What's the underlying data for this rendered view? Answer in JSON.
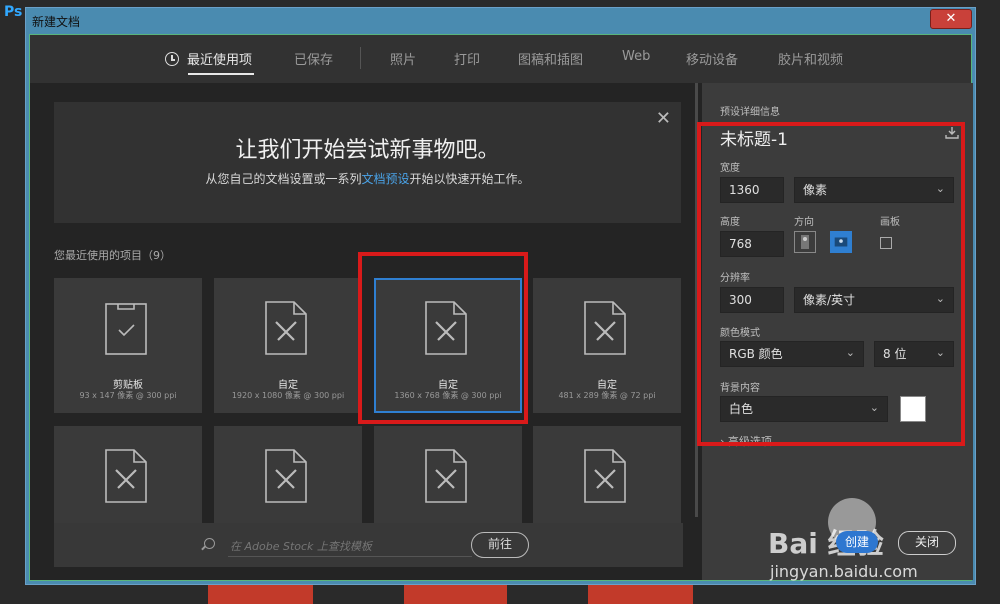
{
  "app": {
    "logo": "Ps",
    "window_title": "新建文档",
    "close_glyph": "✕"
  },
  "tabs": [
    {
      "label": "最近使用项"
    },
    {
      "label": "已保存"
    },
    {
      "label": "照片"
    },
    {
      "label": "打印"
    },
    {
      "label": "图稿和插图"
    },
    {
      "label": "Web"
    },
    {
      "label": "移动设备"
    },
    {
      "label": "胶片和视频"
    }
  ],
  "welcome": {
    "heading": "让我们开始尝试新事物吧。",
    "sub_before": "从您自己的文档设置或一系列",
    "sub_link": "文档预设",
    "sub_after": "开始以快速开始工作。",
    "close_glyph": "✕"
  },
  "recent": {
    "label": "您最近使用的项目（9）",
    "items": [
      {
        "name": "剪贴板",
        "meta": "93 x 147 像素 @ 300 ppi",
        "icon": "clipboard-icon"
      },
      {
        "name": "自定",
        "meta": "1920 x 1080 像素 @ 300 ppi",
        "icon": "custom-document-icon"
      },
      {
        "name": "自定",
        "meta": "1360 x 768 像素 @ 300 ppi",
        "icon": "custom-document-icon",
        "selected": true
      },
      {
        "name": "自定",
        "meta": "481 x 289 像素 @ 72 ppi",
        "icon": "custom-document-icon"
      },
      {
        "name": "",
        "meta": "",
        "icon": "custom-document-icon"
      },
      {
        "name": "",
        "meta": "",
        "icon": "custom-document-icon"
      },
      {
        "name": "",
        "meta": "",
        "icon": "custom-document-icon"
      },
      {
        "name": "",
        "meta": "",
        "icon": "custom-document-icon"
      }
    ]
  },
  "search": {
    "placeholder": "在 Adobe Stock 上查找模板",
    "go_label": "前往"
  },
  "details": {
    "section_label": "预设详细信息",
    "doc_name": "未标题-1",
    "width_label": "宽度",
    "width_value": "1360",
    "width_unit": "像素",
    "height_label": "高度",
    "height_value": "768",
    "orientation_label": "方向",
    "artboard_label": "画板",
    "resolution_label": "分辨率",
    "resolution_value": "300",
    "resolution_unit": "像素/英寸",
    "color_mode_label": "颜色模式",
    "color_mode_value": "RGB 颜色",
    "bit_depth_value": "8 位",
    "background_label": "背景内容",
    "background_value": "白色",
    "advanced_label": "高级选项"
  },
  "watermark": {
    "text": "Bai 经验",
    "url": "jingyan.baidu.com",
    "btn1": "创建",
    "btn2": "关闭"
  },
  "colors": {
    "accent": "#2f7fd1",
    "highlight": "#d91a1a",
    "panel": "#3c3c3c"
  }
}
